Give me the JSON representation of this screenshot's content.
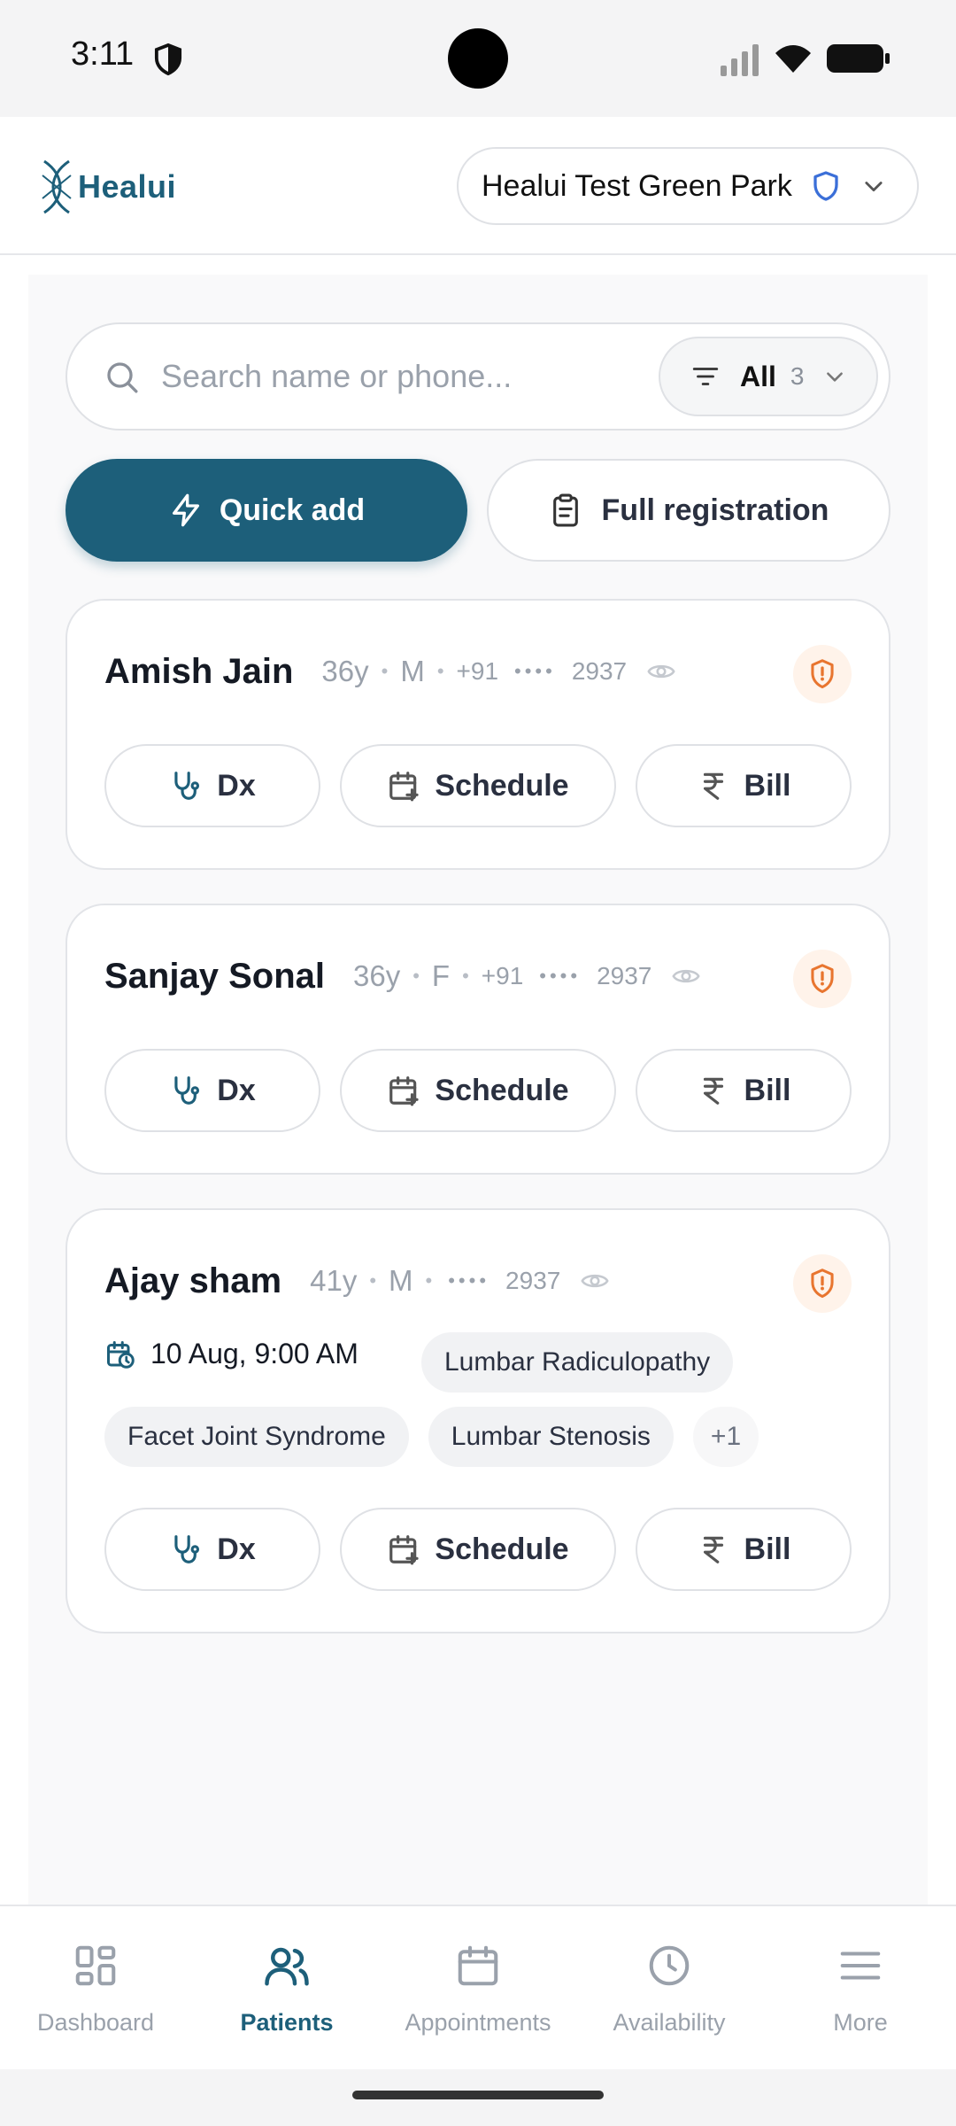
{
  "status_bar": {
    "time": "3:11"
  },
  "header": {
    "logo_text": "Healui",
    "clinic_name": "Healui Test Green Park"
  },
  "search": {
    "placeholder": "Search name or phone...",
    "value": "",
    "filter_label": "All",
    "filter_count": "3"
  },
  "actions": {
    "quick_add": "Quick add",
    "full_registration": "Full registration"
  },
  "patients": [
    {
      "name": "Amish Jain",
      "age": "36y",
      "sex": "M",
      "code": "+91",
      "mask": "••••",
      "phone_last": "2937",
      "actions": {
        "dx": "Dx",
        "schedule": "Schedule",
        "bill": "Bill"
      }
    },
    {
      "name": "Sanjay Sonal",
      "age": "36y",
      "sex": "F",
      "code": "+91",
      "mask": "••••",
      "phone_last": "2937",
      "actions": {
        "dx": "Dx",
        "schedule": "Schedule",
        "bill": "Bill"
      }
    },
    {
      "name": "Ajay sham",
      "age": "41y",
      "sex": "M",
      "mask": "••••",
      "phone_last": "2937",
      "appointment": "10 Aug, 9:00 AM",
      "tags": [
        "Lumbar Radiculopathy",
        "Facet Joint Syndrome",
        "Lumbar Stenosis"
      ],
      "more_tags": "+1",
      "actions": {
        "dx": "Dx",
        "schedule": "Schedule",
        "bill": "Bill"
      }
    }
  ],
  "bottom_nav": {
    "items": [
      {
        "label": "Dashboard",
        "icon": "grid-icon"
      },
      {
        "label": "Patients",
        "icon": "users-icon",
        "active": true
      },
      {
        "label": "Appointments",
        "icon": "calendar-icon"
      },
      {
        "label": "Availability",
        "icon": "clock-icon"
      },
      {
        "label": "More",
        "icon": "menu-icon"
      }
    ]
  },
  "colors": {
    "brand": "#1d5f7a",
    "alert": "#e8752f",
    "shield_blue": "#3b6fd8"
  }
}
